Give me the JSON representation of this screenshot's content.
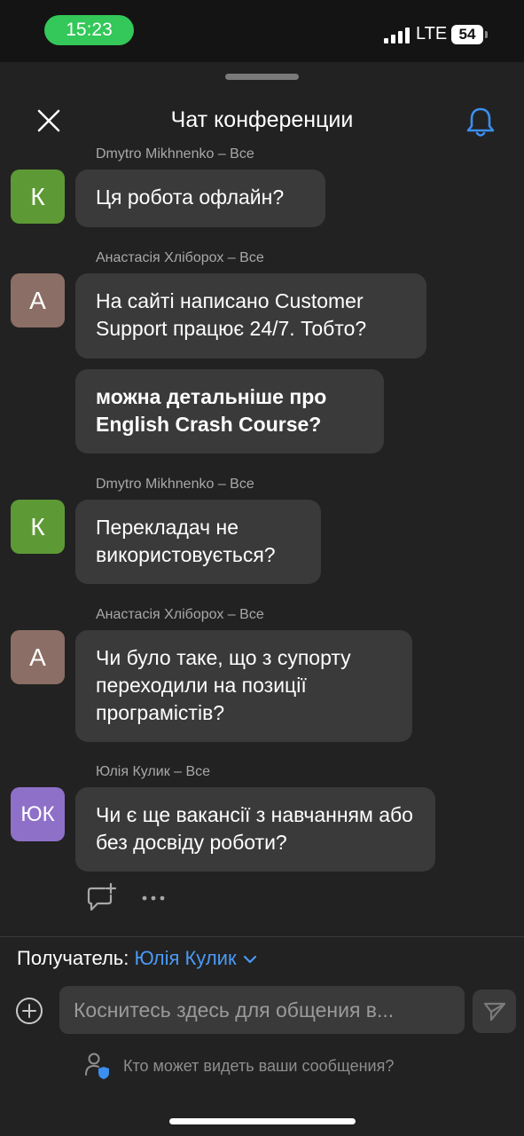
{
  "status_bar": {
    "time": "15:23",
    "network": "LTE",
    "battery": "54"
  },
  "header": {
    "title": "Чат конференции",
    "close_icon": "close-icon",
    "bell_icon": "bell-icon"
  },
  "messages": [
    {
      "sender": "Dmytro Mikhnenko – Все",
      "avatar": "К",
      "text": "Ця робота офлайн?"
    },
    {
      "sender": "Анастасія Хліборох – Все",
      "avatar": "А",
      "text": "На сайті написано Customer Support працює 24/7. Тобто?"
    },
    {
      "text": "можна детальніше про English Crash Course?"
    },
    {
      "sender": "Dmytro Mikhnenko – Все",
      "avatar": "К",
      "text": "Перекладач не використовується?"
    },
    {
      "sender": "Анастасія Хліборох – Все",
      "avatar": "А",
      "text": "Чи було таке, що з супорту переходили на позиції програмістів?"
    },
    {
      "sender": "Юлія Кулик – Все",
      "avatar": "ЮК",
      "text": "Чи є ще вакансії з навчанням або без досвіду роботи?"
    }
  ],
  "composer": {
    "recipient_label": "Получатель:",
    "recipient_name": "Юлія Кулик",
    "placeholder": "Коснитесь здесь для общения в...",
    "privacy_text": "Кто может видеть ваши сообщения?"
  },
  "colors": {
    "accent": "#4a9af5",
    "background": "#222222",
    "bubble": "#3a3a3a",
    "time_pill": "#34c759"
  }
}
